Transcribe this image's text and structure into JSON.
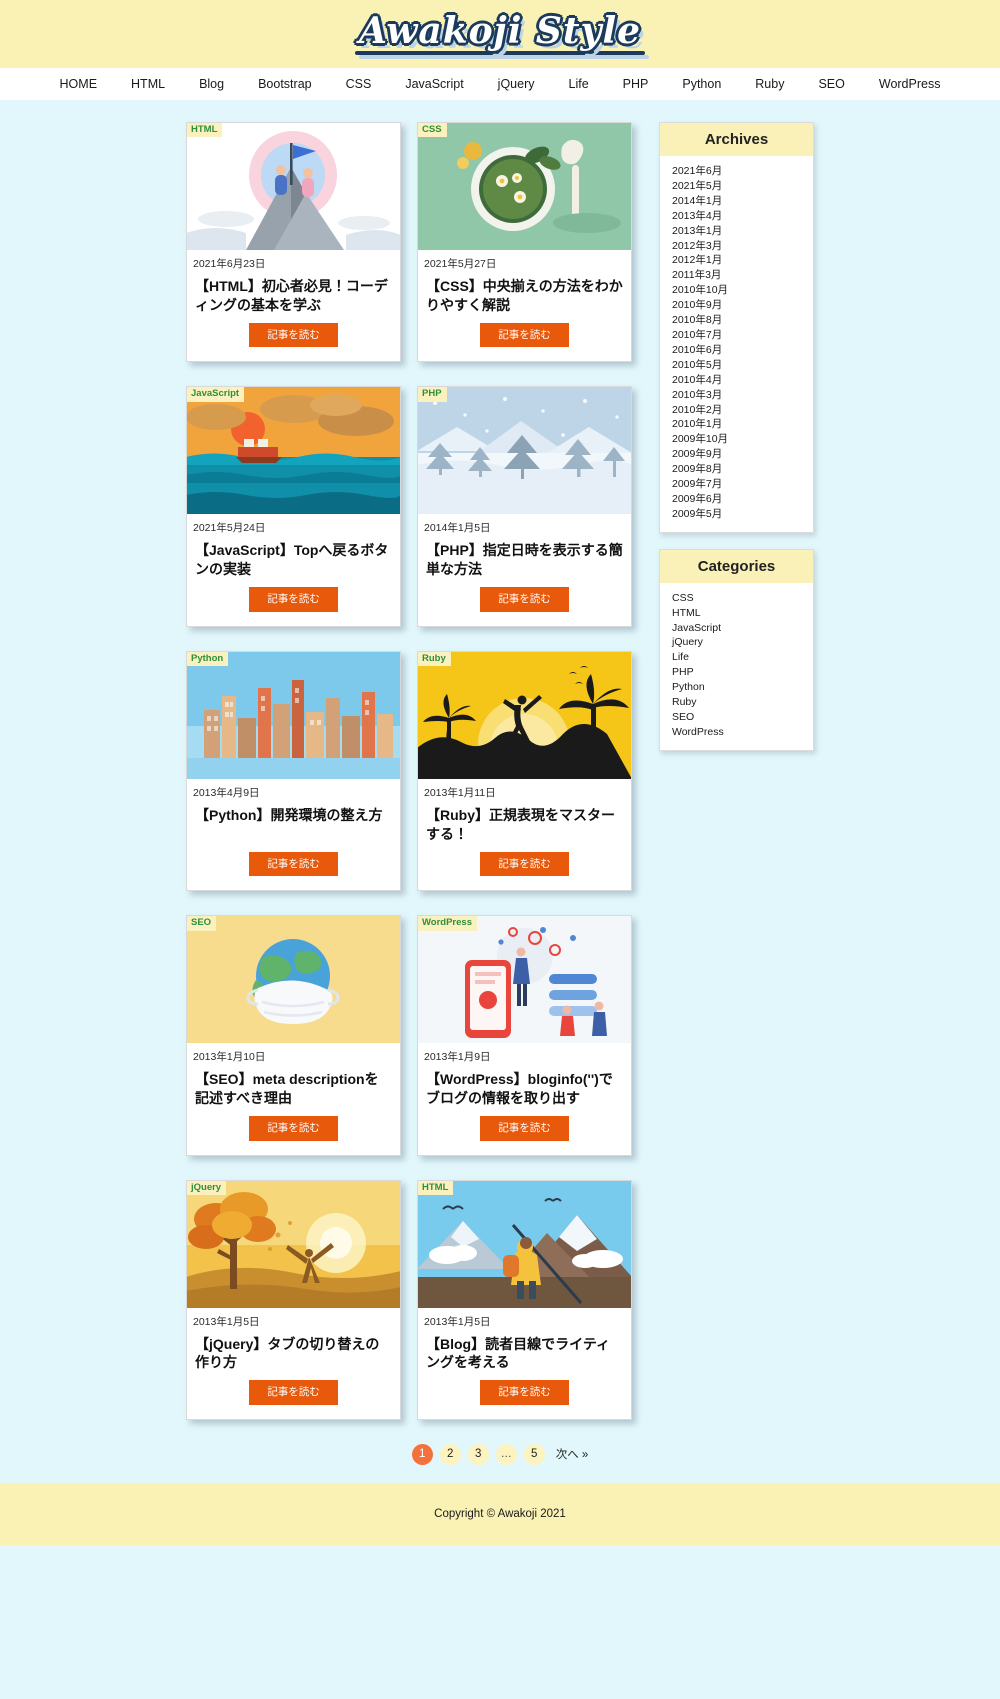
{
  "header": {
    "logo_text": "Awakoji Style"
  },
  "nav": {
    "items": [
      {
        "label": "HOME"
      },
      {
        "label": "HTML"
      },
      {
        "label": "Blog"
      },
      {
        "label": "Bootstrap"
      },
      {
        "label": "CSS"
      },
      {
        "label": "JavaScript"
      },
      {
        "label": "jQuery"
      },
      {
        "label": "Life"
      },
      {
        "label": "PHP"
      },
      {
        "label": "Python"
      },
      {
        "label": "Ruby"
      },
      {
        "label": "SEO"
      },
      {
        "label": "WordPress"
      }
    ]
  },
  "posts": [
    {
      "badge": "HTML",
      "date": "2021年6月23日",
      "title": "【HTML】初心者必見！コーディングの基本を学ぶ",
      "button": "記事を読む",
      "thumb": "mountain-flag-illustration"
    },
    {
      "badge": "CSS",
      "date": "2021年5月27日",
      "title": "【CSS】中央揃えの方法をわかりやすく解説",
      "button": "記事を読む",
      "thumb": "matcha-tea-illustration"
    },
    {
      "badge": "JavaScript",
      "date": "2021年5月24日",
      "title": "【JavaScript】Topへ戻るボタンの実装",
      "button": "記事を読む",
      "thumb": "sunset-sea-boat-illustration"
    },
    {
      "badge": "PHP",
      "date": "2014年1月5日",
      "title": "【PHP】指定日時を表示する簡単な方法",
      "button": "記事を読む",
      "thumb": "winter-snow-trees-illustration"
    },
    {
      "badge": "Python",
      "date": "2013年4月9日",
      "title": "【Python】開発環境の整え方",
      "button": "記事を読む",
      "thumb": "city-skyline-illustration"
    },
    {
      "badge": "Ruby",
      "date": "2013年1月11日",
      "title": "【Ruby】正規表現をマスターする！",
      "button": "記事を読む",
      "thumb": "palm-tree-sunset-yoga-illustration"
    },
    {
      "badge": "SEO",
      "date": "2013年1月10日",
      "title": "【SEO】meta descriptionを記述すべき理由",
      "button": "記事を読む",
      "thumb": "globe-mask-illustration"
    },
    {
      "badge": "WordPress",
      "date": "2013年1月9日",
      "title": "【WordPress】bloginfo('')でブログの情報を取り出す",
      "button": "記事を読む",
      "thumb": "mobile-marketing-illustration"
    },
    {
      "badge": "jQuery",
      "date": "2013年1月5日",
      "title": "【jQuery】タブの切り替えの作り方",
      "button": "記事を読む",
      "thumb": "autumn-tree-sunrise-illustration"
    },
    {
      "badge": "HTML",
      "date": "2013年1月5日",
      "title": "【Blog】読者目線でライティングを考える",
      "button": "記事を読む",
      "thumb": "hiker-mountain-illustration"
    }
  ],
  "sidebar": {
    "archives": {
      "title": "Archives",
      "items": [
        "2021年6月",
        "2021年5月",
        "2014年1月",
        "2013年4月",
        "2013年1月",
        "2012年3月",
        "2012年1月",
        "2011年3月",
        "2010年10月",
        "2010年9月",
        "2010年8月",
        "2010年7月",
        "2010年6月",
        "2010年5月",
        "2010年4月",
        "2010年3月",
        "2010年2月",
        "2010年1月",
        "2009年10月",
        "2009年9月",
        "2009年8月",
        "2009年7月",
        "2009年6月",
        "2009年5月"
      ]
    },
    "categories": {
      "title": "Categories",
      "items": [
        "CSS",
        "HTML",
        "JavaScript",
        "jQuery",
        "Life",
        "PHP",
        "Python",
        "Ruby",
        "SEO",
        "WordPress"
      ]
    }
  },
  "pagination": {
    "pages": [
      "1",
      "2",
      "3"
    ],
    "ellipsis": "…",
    "last": "5",
    "next_label": "次へ »",
    "current": "1"
  },
  "footer": {
    "copyright": "Copyright © Awakoji 2021"
  },
  "colors": {
    "header_bg": "#faf2b4",
    "page_bg": "#e2f7fb",
    "accent": "#e8590c",
    "badge_bg": "#fbf1bf",
    "badge_text": "#2f8f3e",
    "widget_head_bg": "#faf1b8",
    "pagination_active": "#f4713b"
  }
}
